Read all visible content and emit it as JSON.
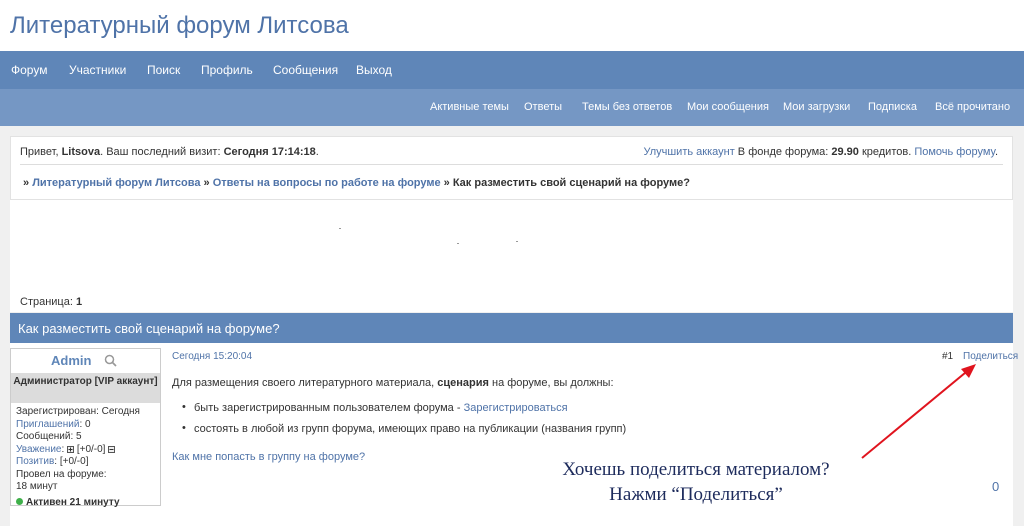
{
  "site": {
    "title": "Литературный форум Литсова"
  },
  "main_nav": [
    "Форум",
    "Участники",
    "Поиск",
    "Профиль",
    "Сообщения",
    "Выход"
  ],
  "sub_nav": [
    "Активные темы",
    "Ответы",
    "Темы без ответов",
    "Мои сообщения",
    "Мои загрузки",
    "Подписка",
    "Всё прочитано"
  ],
  "welcome": {
    "greeting": "Привет, ",
    "username": "Litsova",
    "last_visit_label": ". Ваш последний визит: ",
    "last_visit_value": "Сегодня 17:14:18",
    "upgrade_link": "Улучшить аккаунт",
    "fund_label": " В фонде форума: ",
    "fund_value": "29.90",
    "credits_label": " кредитов. ",
    "help_link": "Помочь форуму",
    "help_suffix": "."
  },
  "breadcrumb": {
    "sep": "» ",
    "item1": "Литературный форум Литсова",
    "sep2": " » ",
    "item2": "Ответы на вопросы по работе на форуме",
    "sep3": " » ",
    "current": "Как разместить свой сценарий на форуме?"
  },
  "pagination": {
    "label": "Страница: ",
    "current": "1"
  },
  "topic": {
    "title": "Как разместить свой сценарий на форуме?"
  },
  "author": {
    "name": "Admin",
    "role": "Администратор [VIP аккаунт]",
    "registered": "Зарегистрирован: Сегодня",
    "invites_label": "Приглашений",
    "invites_value": ": 0",
    "messages": "Сообщений: 5",
    "respect_label": "Уважение",
    "respect_value": "[+0/-0]",
    "positive_label": "Позитив",
    "positive_value": ": [+0/-0]",
    "time_on_forum_label": "Провел на форуме:",
    "time_on_forum_value": "18 минут",
    "active": "Активен 21 минуту"
  },
  "post": {
    "time": "Сегодня 15:20:04",
    "number": "#1",
    "share": "Поделиться",
    "intro_pre": "Для размещения своего литературного материала, ",
    "intro_bold": "сценария",
    "intro_post": " на форуме, вы должны:",
    "bullet1_text": "быть зарегистрированным пользователем форума - ",
    "bullet1_link": "Зарегистрироваться",
    "bullet2_text": "состоять в любой из групп форума, имеющих право на публикации (названия групп)",
    "link": "Как мне попасть в группу на форуме?",
    "counter": "0"
  },
  "annotation": {
    "line1": "Хочешь поделиться материалом?",
    "line2": "Нажми “Поделиться”",
    "arrow_color": "#e0141e"
  }
}
